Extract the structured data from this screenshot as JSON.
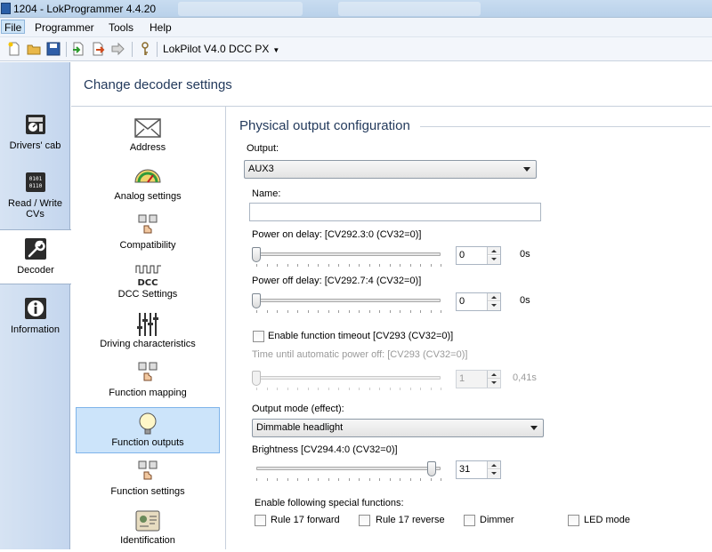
{
  "window": {
    "title": "1204 - LokProgrammer 4.4.20"
  },
  "menu": [
    "File",
    "Programmer",
    "Tools",
    "Help"
  ],
  "toolbar": {
    "device": "LokPilot V4.0 DCC PX"
  },
  "nav": [
    {
      "label": "Drivers' cab",
      "icon": "drivers-cab-icon"
    },
    {
      "label": "Read / Write CVs",
      "icon": "read-write-cvs-icon"
    },
    {
      "label": "Decoder",
      "icon": "wrench-icon"
    },
    {
      "label": "Information",
      "icon": "info-icon"
    }
  ],
  "header": {
    "title": "Change decoder settings"
  },
  "categories": [
    {
      "label": "Address",
      "icon": "envelope-icon"
    },
    {
      "label": "Analog settings",
      "icon": "gauge-icon"
    },
    {
      "label": "Compatibility",
      "icon": "hand-buttons-icon"
    },
    {
      "label": "DCC Settings",
      "icon": "dcc-icon",
      "icon_text": "DCC"
    },
    {
      "label": "Driving characteristics",
      "icon": "sliders-icon"
    },
    {
      "label": "Function mapping",
      "icon": "hand-buttons-icon"
    },
    {
      "label": "Function outputs",
      "icon": "bulb-icon"
    },
    {
      "label": "Function settings",
      "icon": "hand-buttons-icon"
    },
    {
      "label": "Identification",
      "icon": "id-card-icon"
    }
  ],
  "panel": {
    "section_title": "Physical output configuration",
    "output_label": "Output:",
    "output_value": "AUX3",
    "name_label": "Name:",
    "name_value": "",
    "power_on_label": "Power on delay: [CV292.3:0 (CV32=0)]",
    "power_on_value": "0",
    "power_on_unit": "0s",
    "power_on_level": 0,
    "power_off_label": "Power off delay: [CV292.7:4 (CV32=0)]",
    "power_off_value": "0",
    "power_off_unit": "0s",
    "power_off_level": 0,
    "timeout_checkbox_label": "Enable function timeout [CV293 (CV32=0)]",
    "timeout_checked": false,
    "auto_off_label": "Time until automatic power off: [CV293 (CV32=0)]",
    "auto_off_value": "1",
    "auto_off_unit": "0,41s",
    "auto_off_level": 0,
    "output_mode_label": "Output mode (effect):",
    "output_mode_value": "Dimmable headlight",
    "brightness_label": "Brightness [CV294.4:0 (CV32=0)]",
    "brightness_value": "31",
    "brightness_level": 1.0,
    "special_label": "Enable following special functions:",
    "special": [
      {
        "label": "Rule 17 forward",
        "checked": false
      },
      {
        "label": "Rule 17 reverse",
        "checked": false
      },
      {
        "label": "Dimmer",
        "checked": false
      },
      {
        "label": "LED mode",
        "checked": false
      }
    ]
  },
  "colors": {
    "nav_bg": "#c4d6ee",
    "selected_bg": "#cce4fa",
    "header_text": "#233a5c"
  }
}
